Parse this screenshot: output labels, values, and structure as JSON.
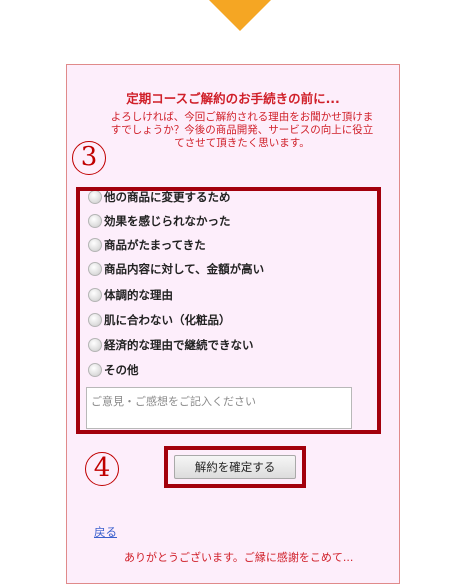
{
  "panel": {
    "title": "定期コースご解約のお手続きの前に...",
    "intro": "よろしければ、今回ご解約される理由をお聞かせ頂けますでしょうか？今後の商品開発、サービスの向上に役立てさせて頂きたく思います。"
  },
  "markers": {
    "step3": "3",
    "step4": "4"
  },
  "options": [
    "他の商品に変更するため",
    "効果を感じられなかった",
    "商品がたまってきた",
    "商品内容に対して、金額が高い",
    "体調的な理由",
    "肌に合わない（化粧品）",
    "経済的な理由で継続できない",
    "その他"
  ],
  "comment": {
    "placeholder": "ご意見・ご感想をご記入ください"
  },
  "confirm_label": "解約を確定する",
  "back_link": "戻る",
  "thanks_text": "ありがとうございます。ご縁に感謝をこめて..."
}
